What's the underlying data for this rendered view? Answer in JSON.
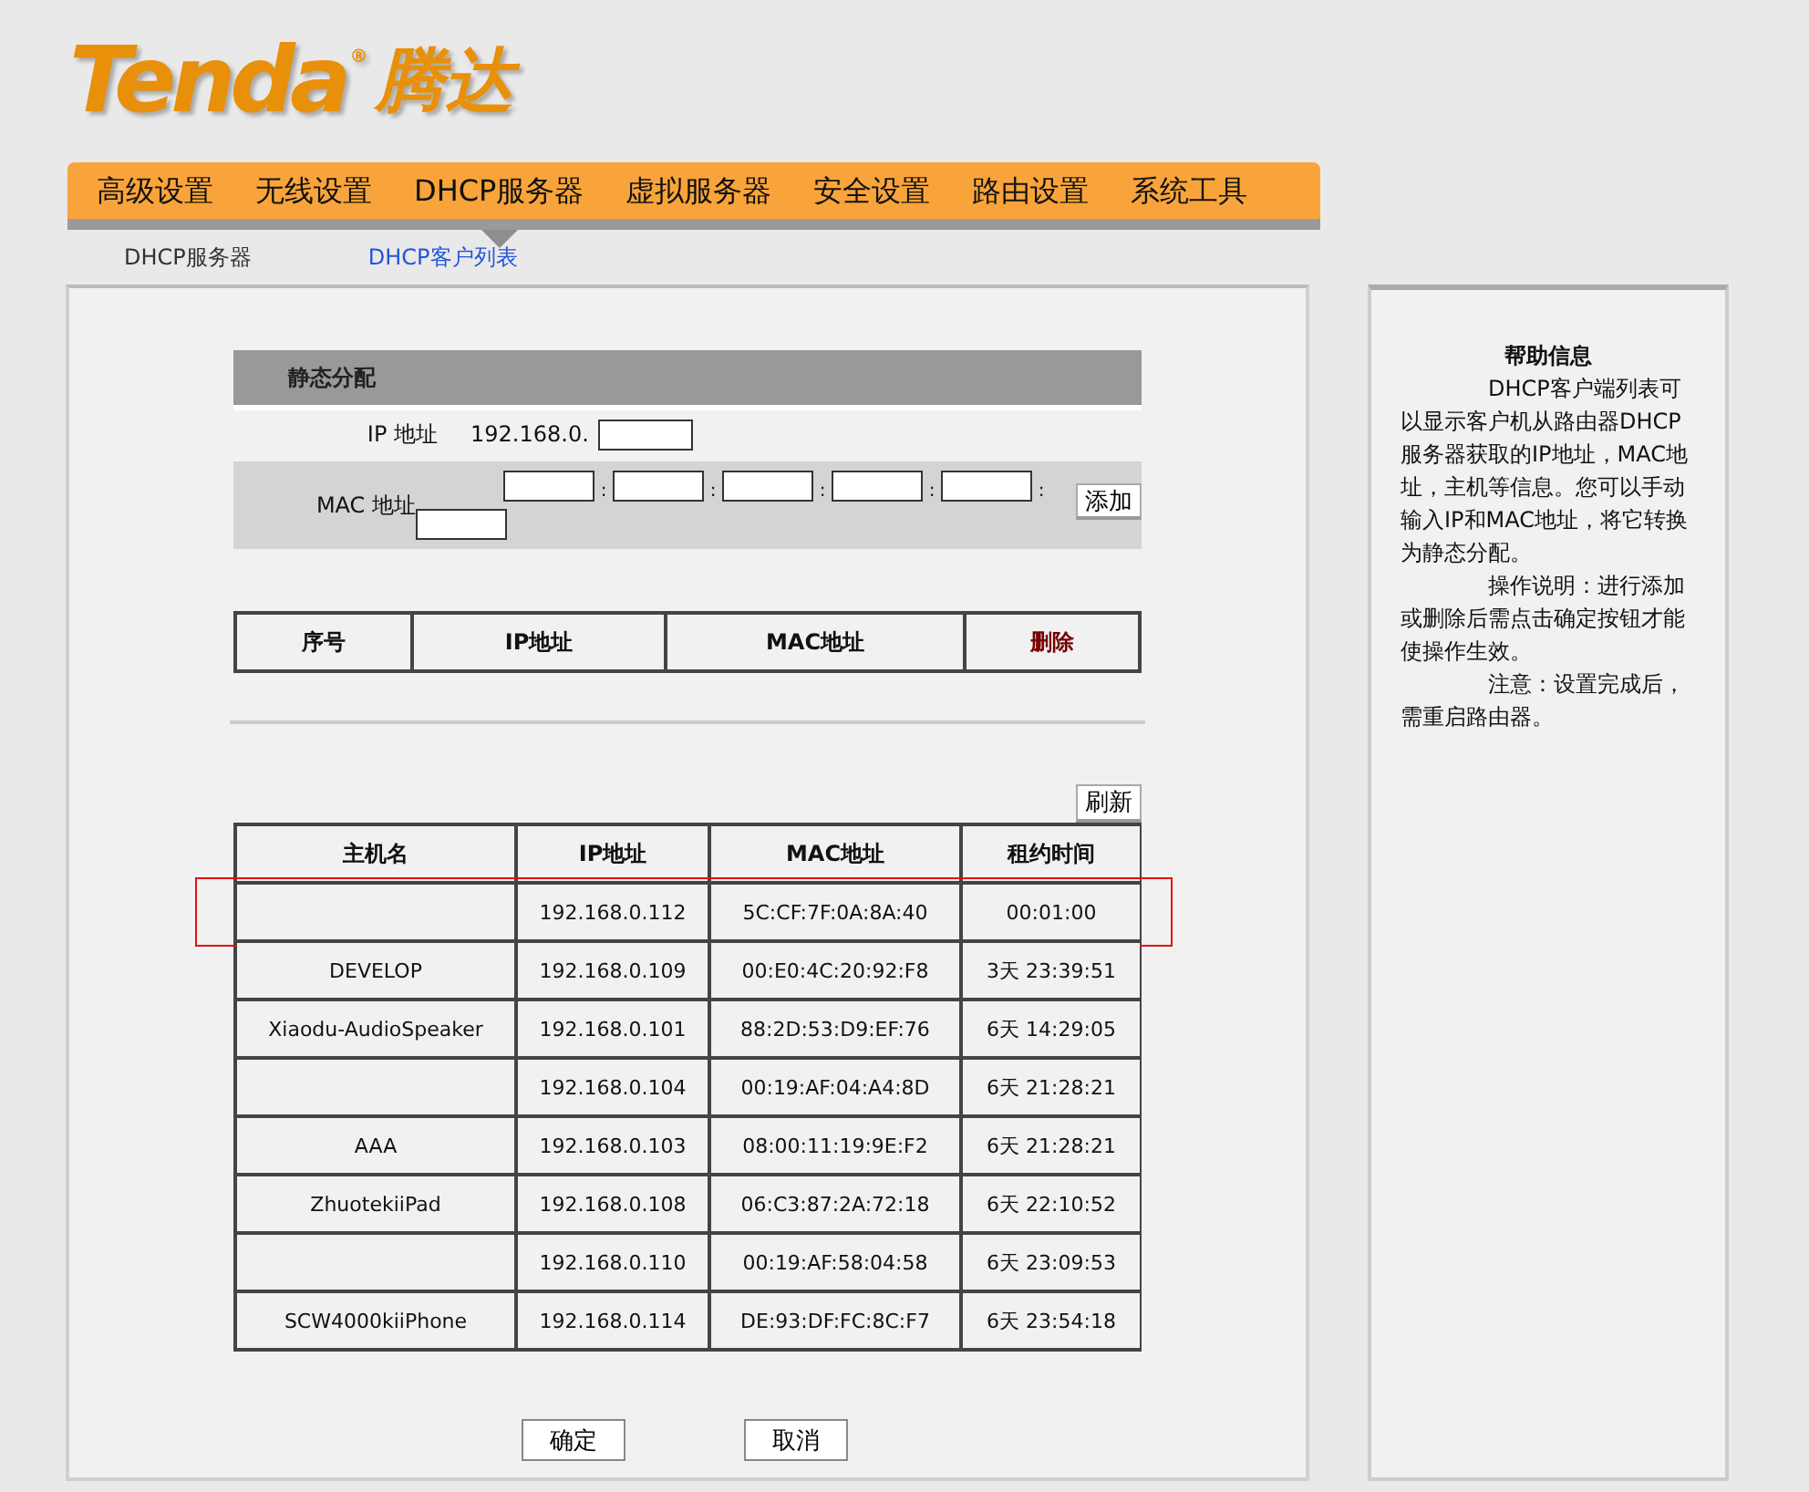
{
  "logo": {
    "brand": "Tenda",
    "registered": "®",
    "brand_cn": "腾达"
  },
  "nav": [
    {
      "label": "高级设置",
      "selected": false
    },
    {
      "label": "无线设置",
      "selected": false
    },
    {
      "label": "DHCP服务器",
      "selected": true
    },
    {
      "label": "虚拟服务器",
      "selected": false
    },
    {
      "label": "安全设置",
      "selected": false
    },
    {
      "label": "路由设置",
      "selected": false
    },
    {
      "label": "系统工具",
      "selected": false
    }
  ],
  "subnav": [
    {
      "label": "DHCP服务器",
      "selected": false
    },
    {
      "label": "DHCP客户列表",
      "selected": true
    }
  ],
  "static_assignment": {
    "title": "静态分配",
    "ip_label": "IP 地址",
    "ip_prefix": "192.168.0.",
    "mac_label": "MAC 地址",
    "mac_separators": [
      ":",
      ":",
      ":",
      ":",
      ":"
    ],
    "add_button": "添加"
  },
  "static_table": {
    "columns": [
      {
        "label": "序号",
        "kind": "plain"
      },
      {
        "label": "IP地址",
        "kind": "plain"
      },
      {
        "label": "MAC地址",
        "kind": "plain"
      },
      {
        "label": "删除",
        "kind": "action"
      }
    ]
  },
  "client_table": {
    "refresh_button": "刷新",
    "columns": [
      "主机名",
      "IP地址",
      "MAC地址",
      "租约时间"
    ],
    "rows": [
      {
        "ip": "192.168.0.112",
        "mac": "5C:CF:7F:0A:8A:40",
        "lease": "00:01:00",
        "highlighted": true
      },
      {
        "host": "DEVELOP",
        "ip": "192.168.0.109",
        "mac": "00:E0:4C:20:92:F8",
        "lease": "3天 23:39:51",
        "highlighted": false
      },
      {
        "host": "Xiaodu-AudioSpeaker",
        "ip": "192.168.0.101",
        "mac": "88:2D:53:D9:EF:76",
        "lease": "6天 14:29:05",
        "highlighted": false
      },
      {
        "ip": "192.168.0.104",
        "mac": "00:19:AF:04:A4:8D",
        "lease": "6天 21:28:21",
        "highlighted": false
      },
      {
        "host": "AAA",
        "ip": "192.168.0.103",
        "mac": "08:00:11:19:9E:F2",
        "lease": "6天 21:28:21",
        "highlighted": false
      },
      {
        "host": "ZhuotekiiPad",
        "ip": "192.168.0.108",
        "mac": "06:C3:87:2A:72:18",
        "lease": "6天 22:10:52",
        "highlighted": false
      },
      {
        "ip": "192.168.0.110",
        "mac": "00:19:AF:58:04:58",
        "lease": "6天 23:09:53",
        "highlighted": false
      },
      {
        "host": "SCW4000kiiPhone",
        "ip": "192.168.0.114",
        "mac": "DE:93:DF:FC:8C:F7",
        "lease": "6天 23:54:18",
        "highlighted": false
      }
    ]
  },
  "buttons": [
    "确定",
    "取消"
  ],
  "help": {
    "title": "帮助信息",
    "paragraphs": [
      "DHCP客户端列表可以显示客户机从路由器DHCP服务器获取的IP地址，MAC地址，主机等信息。您可以手动输入IP和MAC地址，将它转换为静态分配。",
      "操作说明：进行添加或删除后需点击确定按钮才能使操作生效。",
      "注意：设置完成后，需重启路由器。"
    ]
  }
}
